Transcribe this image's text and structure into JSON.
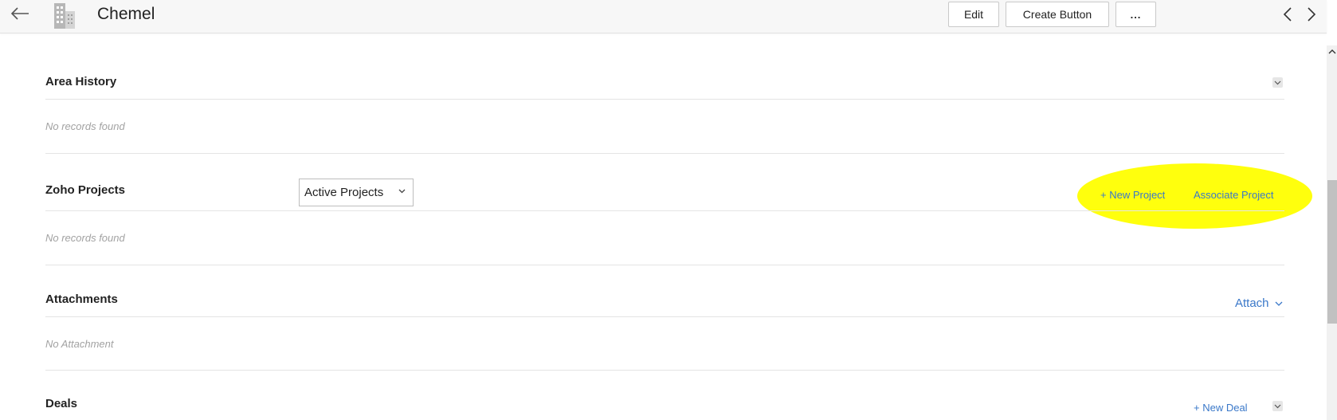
{
  "header": {
    "record_name": "Chemel",
    "back_icon": "arrow-left-icon",
    "record_icon": "building-icon",
    "buttons": {
      "edit": "Edit",
      "create": "Create Button",
      "more": "..."
    }
  },
  "sections": {
    "area_history": {
      "title": "Area History",
      "empty_text": "No records found"
    },
    "zoho_projects": {
      "title": "Zoho Projects",
      "filter_selected": "Active Projects",
      "new_link": "+ New Project",
      "associate_link": "Associate Project",
      "empty_text": "No records found"
    },
    "attachments": {
      "title": "Attachments",
      "attach_link": "Attach",
      "empty_text": "No Attachment"
    },
    "deals": {
      "title": "Deals",
      "new_link": "+ New Deal"
    }
  },
  "colors": {
    "link": "#3a78c9",
    "highlight": "#ffff00"
  }
}
